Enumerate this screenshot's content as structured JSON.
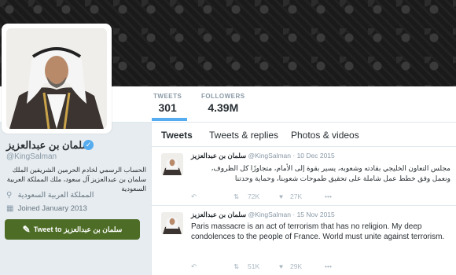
{
  "profile": {
    "name": "سلمان بن عبدالعزيز",
    "handle": "@KingSalman",
    "bio": "الحساب الرسمي لخادم الحرمين الشريفين الملك سلمان بن عبدالعزيز آل سعود، ملك المملكة العربية السعودية",
    "location": "المملكة العربية السعودية",
    "joined": "Joined January 2013",
    "tweet_to_label": "Tweet to سلمان بن عبدالعزيز"
  },
  "stats": {
    "tweets_label": "TWEETS",
    "tweets_value": "301",
    "followers_label": "FOLLOWERS",
    "followers_value": "4.39M"
  },
  "tabs": [
    {
      "label": "Tweets"
    },
    {
      "label": "Tweets & replies"
    },
    {
      "label": "Photos & videos"
    }
  ],
  "tweets": [
    {
      "name": "سلمان بن عبدالعزيز",
      "handle": "@KingSalman",
      "date": "10 Dec 2015",
      "text": "مجلس التعاون الخليجي بقادته وشعوبه، يسير بقوة إلى الأمام، متجاوزًا كل الظروف، ونعمل وفق خطط عمل شاملة على تحقيق طموحات شعوبنا، وحماية وحدتنا",
      "retweets": "72K",
      "likes": "27K"
    },
    {
      "name": "سلمان بن عبدالعزيز",
      "handle": "@KingSalman",
      "date": "15 Nov 2015",
      "text": "Paris massacre is an act of terrorism that has no religion. My deep condolences to the people of France. World must unite against terrorism.",
      "retweets": "51K",
      "likes": "29K"
    }
  ],
  "colors": {
    "accent": "#55acee",
    "tweet_to_button": "#4d6d26",
    "banner": "#1b1b1b"
  }
}
